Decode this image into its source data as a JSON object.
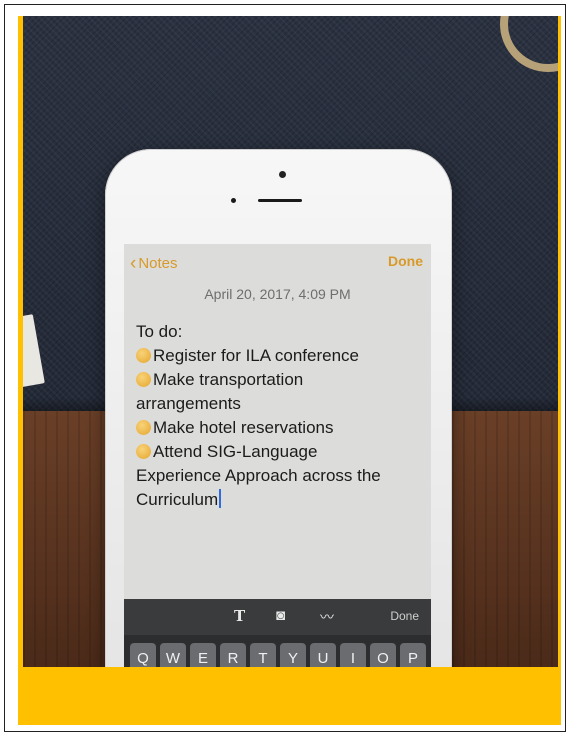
{
  "notes_app": {
    "back_label": "Notes",
    "done_label": "Done",
    "timestamp": "April 20, 2017, 4:09 PM",
    "note_lines": [
      {
        "emoji": false,
        "text": "To do:"
      },
      {
        "emoji": true,
        "text": "Register for ILA conference"
      },
      {
        "emoji": true,
        "text": "Make transportation"
      },
      {
        "emoji": false,
        "text": "arrangements"
      },
      {
        "emoji": true,
        "text": "Make hotel reservations"
      },
      {
        "emoji": true,
        "text": "Attend  SIG-Language"
      },
      {
        "emoji": false,
        "text": "Experience Approach across the"
      },
      {
        "emoji": false,
        "text": "Curriculum"
      }
    ]
  },
  "toolbar": {
    "format_icon": "T",
    "camera_icon": "camera-icon",
    "sketch_icon": "sketch-icon",
    "done_label": "Done"
  },
  "keyboard": {
    "row1": [
      "Q",
      "W",
      "E",
      "R",
      "T",
      "Y",
      "U",
      "I",
      "O",
      "P"
    ]
  },
  "colors": {
    "accent": "#d89a2a",
    "frame_yellow": "#ffc000",
    "cursor": "#2e6be3"
  }
}
